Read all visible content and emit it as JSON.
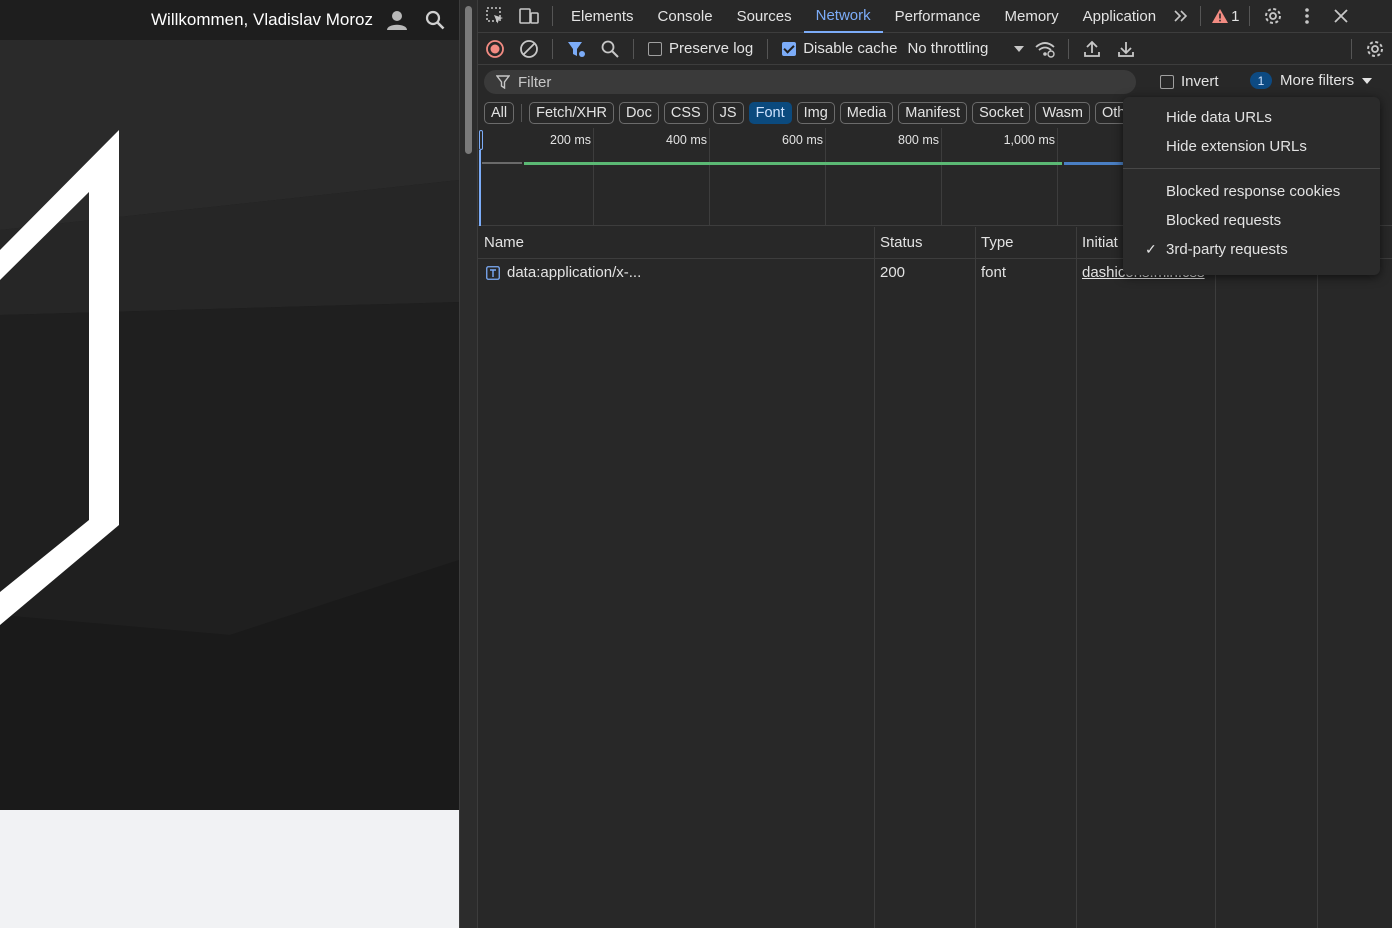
{
  "page": {
    "welcome_text": "Willkommen, Vladislav Moroz",
    "user_icon": "user-icon",
    "search_icon": "search-icon"
  },
  "devtools": {
    "tabs": [
      {
        "label": "Elements"
      },
      {
        "label": "Console"
      },
      {
        "label": "Sources"
      },
      {
        "label": "Network",
        "active": true
      },
      {
        "label": "Performance"
      },
      {
        "label": "Memory"
      },
      {
        "label": "Application"
      }
    ],
    "warning_count": "1",
    "toolbar": {
      "preserve_log": "Preserve log",
      "disable_cache": "Disable cache",
      "throttling": "No throttling"
    },
    "filter": {
      "placeholder": "Filter",
      "invert": "Invert",
      "more_filters_count": "1",
      "more_filters": "More filters"
    },
    "types": [
      "All",
      "Fetch/XHR",
      "Doc",
      "CSS",
      "JS",
      "Font",
      "Img",
      "Media",
      "Manifest",
      "Socket",
      "Wasm",
      "Oth"
    ],
    "active_type": "Font",
    "timeline": {
      "ticks": [
        "200 ms",
        "400 ms",
        "600 ms",
        "800 ms",
        "1,000 ms"
      ]
    },
    "table": {
      "headers": {
        "name": "Name",
        "status": "Status",
        "type": "Type",
        "initiator": "Initiat"
      },
      "rows": [
        {
          "name": "data:application/x-...",
          "status": "200",
          "type": "font",
          "initiator": "dashicons.min.css"
        }
      ]
    },
    "more_filters_menu": {
      "items_group1": [
        "Hide data URLs",
        "Hide extension URLs"
      ],
      "items_group2": [
        "Blocked response cookies",
        "Blocked requests",
        "3rd-party requests"
      ],
      "checked_item": "3rd-party requests"
    },
    "colors": {
      "accent": "#7cacf8",
      "record": "#f28b82",
      "warning": "#f28b82",
      "timeline_bar": "#5bb974"
    }
  }
}
